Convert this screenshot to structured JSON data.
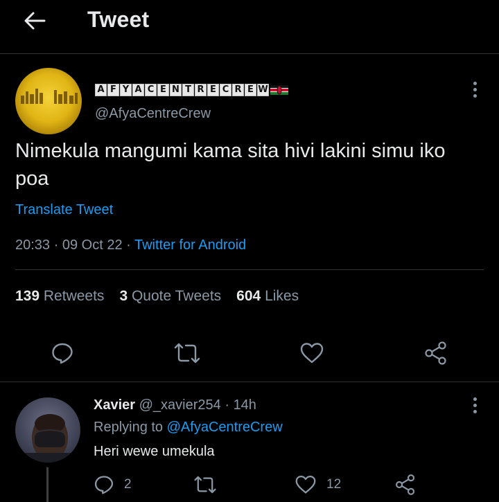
{
  "header": {
    "title": "Tweet",
    "back_icon": "arrow-left-icon"
  },
  "tweet": {
    "display_name_letters": [
      "A",
      "F",
      "Y",
      "A",
      "C",
      "E",
      "N",
      "T",
      "R",
      "E",
      "C",
      "R",
      "E",
      "W"
    ],
    "display_name": "AFYACENTRECREW",
    "flag": "kenya-flag-icon",
    "handle": "@AfyaCentreCrew",
    "avatar_text": "AfyaCentreCrew",
    "text": "Nimekula mangumi kama sita hivi lakini simu iko poa",
    "translate_label": "Translate Tweet",
    "time": "20:33",
    "date": "09 Oct 22",
    "source": "Twitter for Android",
    "stats": {
      "retweets_count": "139",
      "retweets_label": "Retweets",
      "quotes_count": "3",
      "quotes_label": "Quote Tweets",
      "likes_count": "604",
      "likes_label": "Likes"
    }
  },
  "reply": {
    "name": "Xavier",
    "handle": "@_xavier254",
    "time": "14h",
    "replying_prefix": "Replying to",
    "replying_to": "@AfyaCentreCrew",
    "text": "Heri wewe umekula",
    "reply_count": "2",
    "like_count": "12"
  },
  "colors": {
    "accent": "#1d9bf0",
    "muted": "#8b98a5",
    "background": "#000000",
    "text": "#e7e9ea"
  }
}
